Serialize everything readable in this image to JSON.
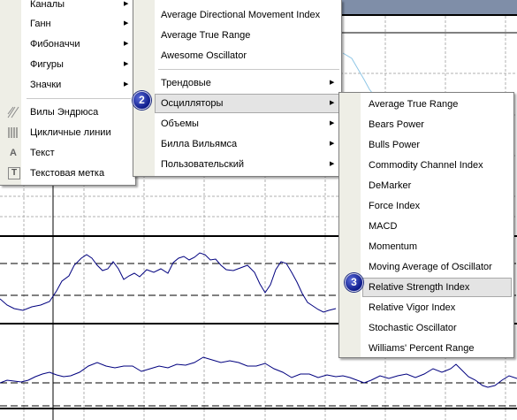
{
  "menu1": {
    "items": [
      {
        "label": "Каналы",
        "submenu": true
      },
      {
        "label": "Ганн",
        "submenu": true
      },
      {
        "label": "Фибоначчи",
        "submenu": true
      },
      {
        "label": "Фигуры",
        "submenu": true
      },
      {
        "label": "Значки",
        "submenu": true
      },
      {
        "label": "Вилы Эндрюса",
        "icon": "andrews-pitchfork-icon"
      },
      {
        "label": "Цикличные линии",
        "icon": "cycle-lines-icon"
      },
      {
        "label": "Текст",
        "icon": "text-icon",
        "icon_glyph": "A"
      },
      {
        "label": "Текстовая метка",
        "icon": "text-label-icon",
        "icon_glyph": "T"
      }
    ]
  },
  "menu2": {
    "items": [
      {
        "label": "Average Directional Movement Index"
      },
      {
        "label": "Average True Range"
      },
      {
        "label": "Awesome Oscillator"
      },
      {
        "label": "Трендовые",
        "submenu": true
      },
      {
        "label": "Осцилляторы",
        "submenu": true,
        "highlighted": true
      },
      {
        "label": "Объемы",
        "submenu": true
      },
      {
        "label": "Билла Вильямса",
        "submenu": true
      },
      {
        "label": "Пользовательский",
        "submenu": true
      }
    ]
  },
  "menu3": {
    "items": [
      {
        "label": "Average True Range"
      },
      {
        "label": "Bears Power"
      },
      {
        "label": "Bulls Power"
      },
      {
        "label": "Commodity Channel Index"
      },
      {
        "label": "DeMarker"
      },
      {
        "label": "Force Index"
      },
      {
        "label": "MACD"
      },
      {
        "label": "Momentum"
      },
      {
        "label": "Moving Average of Oscillator"
      },
      {
        "label": "Relative Strength Index",
        "highlighted": true
      },
      {
        "label": "Relative Vigor Index"
      },
      {
        "label": "Stochastic Oscillator"
      },
      {
        "label": "Williams' Percent Range"
      }
    ]
  },
  "badges": {
    "step2": "2",
    "step3": "3"
  },
  "arrow_glyph": "▶",
  "colors": {
    "line": "#00007f",
    "light_line": "#8ec6e6",
    "highlight": "#e4e4e4",
    "badge": "#0c1a8a",
    "menu_strip": "#eeeee6"
  }
}
